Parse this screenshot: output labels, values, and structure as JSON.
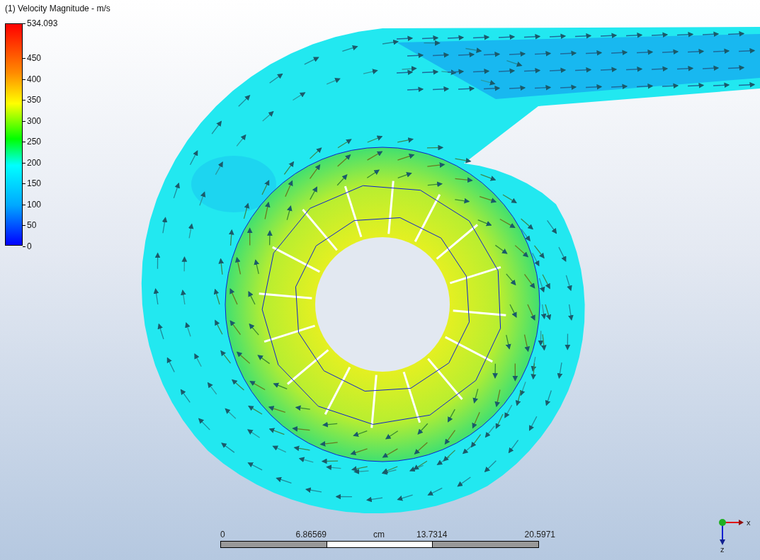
{
  "viewport": {
    "title": "(1) Velocity Magnitude - m/s"
  },
  "legend": {
    "max_label": "534.093",
    "ticks": [
      "450",
      "400",
      "350",
      "300",
      "250",
      "200",
      "150",
      "100",
      "50",
      "0"
    ]
  },
  "scale_bar": {
    "labels": [
      "0",
      "6.86569",
      "13.7314",
      "20.5971"
    ],
    "unit": "cm"
  },
  "axis_triad": {
    "x_label": "x",
    "z_label": "z"
  }
}
